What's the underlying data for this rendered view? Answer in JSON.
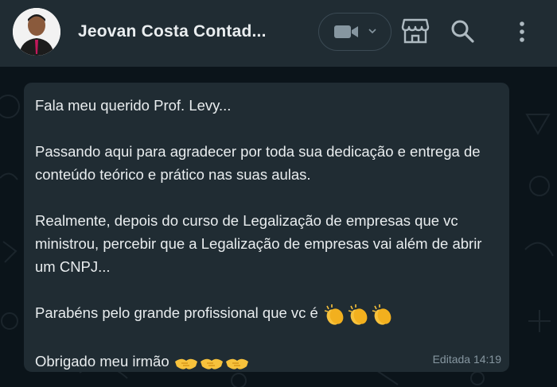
{
  "header": {
    "contact_name": "Jeovan Costa Contad...",
    "icons": [
      "avatar",
      "video-camera-icon",
      "chevron-down-icon",
      "store-icon",
      "search-icon",
      "menu-icon"
    ]
  },
  "message": {
    "lines": [
      "Fala meu querido Prof. Levy...",
      "Passando aqui para agradecer por toda sua dedicação e entrega de conteúdo teórico e prático nas suas aulas.",
      "Realmente, depois do curso de Legalização de empresas que vc ministrou, percebir que a Legalização de empresas vai além de abrir um CNPJ...",
      "Parabéns pelo grande profissional que vc é",
      "Obrigado meu irmão"
    ],
    "emoji_clap": "clapping-hands-emoji",
    "emoji_handshake": "handshake-emoji",
    "edited_label": "Editada",
    "time": "14:19"
  },
  "colors": {
    "header_bg": "#202c33",
    "chat_bg": "#0b141a",
    "bubble_bg": "#202c33",
    "text": "#e9edef",
    "muted": "#8696a0"
  }
}
